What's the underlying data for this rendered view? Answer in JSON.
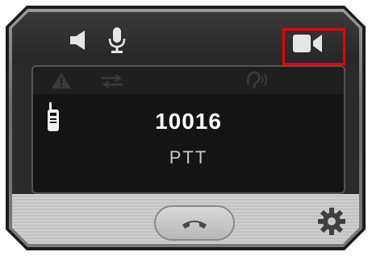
{
  "call": {
    "number": "10016",
    "mode": "PTT"
  },
  "icons": {
    "speaker": "speaker-icon",
    "microphone": "microphone-icon",
    "video": "video-camera-icon",
    "alert": "warning-icon",
    "transfer": "transfer-arrows-icon",
    "hearing": "hearing-icon",
    "radio": "walkie-talkie-icon",
    "hangup": "hangup-icon",
    "settings": "gear-icon"
  },
  "colors": {
    "highlight": "#e8000b",
    "number_text": "#ffffff",
    "mode_text": "#c9c9c9"
  }
}
